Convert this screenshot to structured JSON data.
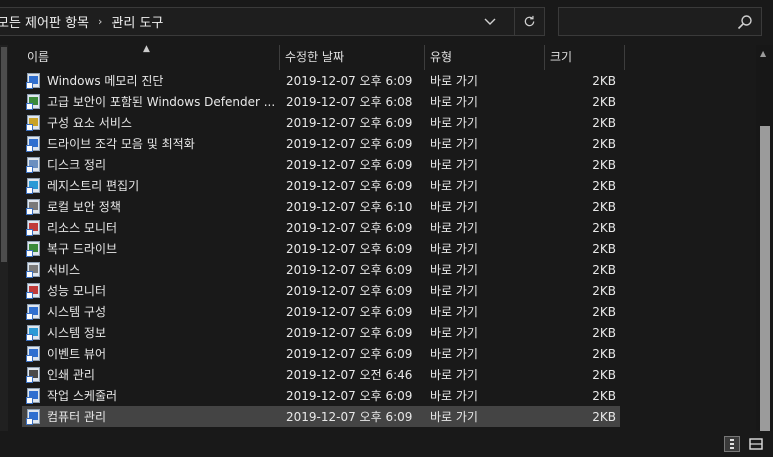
{
  "address": {
    "crumbs": [
      "모든 제어판 항목",
      "관리 도구"
    ],
    "separator": "›"
  },
  "search": {
    "placeholder": ""
  },
  "columns": {
    "name": "이름",
    "date": "수정한 날짜",
    "type": "유형",
    "size": "크기"
  },
  "files": [
    {
      "name": "Windows 메모리 진단",
      "date": "2019-12-07 오후 6:09",
      "type": "바로 가기",
      "size": "2KB",
      "icon": "memory-diagnostic-icon"
    },
    {
      "name": "고급 보안이 포함된 Windows Defender ...",
      "date": "2019-12-07 오후 6:08",
      "type": "바로 가기",
      "size": "2KB",
      "icon": "firewall-icon"
    },
    {
      "name": "구성 요소 서비스",
      "date": "2019-12-07 오후 6:09",
      "type": "바로 가기",
      "size": "2KB",
      "icon": "component-services-icon"
    },
    {
      "name": "드라이브 조각 모음 및 최적화",
      "date": "2019-12-07 오후 6:09",
      "type": "바로 가기",
      "size": "2KB",
      "icon": "defrag-icon"
    },
    {
      "name": "디스크 정리",
      "date": "2019-12-07 오후 6:09",
      "type": "바로 가기",
      "size": "2KB",
      "icon": "disk-cleanup-icon"
    },
    {
      "name": "레지스트리 편집기",
      "date": "2019-12-07 오후 6:09",
      "type": "바로 가기",
      "size": "2KB",
      "icon": "registry-editor-icon"
    },
    {
      "name": "로컬 보안 정책",
      "date": "2019-12-07 오후 6:10",
      "type": "바로 가기",
      "size": "2KB",
      "icon": "local-security-policy-icon"
    },
    {
      "name": "리소스 모니터",
      "date": "2019-12-07 오후 6:09",
      "type": "바로 가기",
      "size": "2KB",
      "icon": "resource-monitor-icon"
    },
    {
      "name": "복구 드라이브",
      "date": "2019-12-07 오후 6:09",
      "type": "바로 가기",
      "size": "2KB",
      "icon": "recovery-drive-icon"
    },
    {
      "name": "서비스",
      "date": "2019-12-07 오후 6:09",
      "type": "바로 가기",
      "size": "2KB",
      "icon": "services-icon"
    },
    {
      "name": "성능 모니터",
      "date": "2019-12-07 오후 6:09",
      "type": "바로 가기",
      "size": "2KB",
      "icon": "performance-monitor-icon"
    },
    {
      "name": "시스템 구성",
      "date": "2019-12-07 오후 6:09",
      "type": "바로 가기",
      "size": "2KB",
      "icon": "system-configuration-icon"
    },
    {
      "name": "시스템 정보",
      "date": "2019-12-07 오후 6:09",
      "type": "바로 가기",
      "size": "2KB",
      "icon": "system-information-icon"
    },
    {
      "name": "이벤트 뷰어",
      "date": "2019-12-07 오후 6:09",
      "type": "바로 가기",
      "size": "2KB",
      "icon": "event-viewer-icon"
    },
    {
      "name": "인쇄 관리",
      "date": "2019-12-07 오전 6:46",
      "type": "바로 가기",
      "size": "2KB",
      "icon": "print-management-icon"
    },
    {
      "name": "작업 스케줄러",
      "date": "2019-12-07 오후 6:09",
      "type": "바로 가기",
      "size": "2KB",
      "icon": "task-scheduler-icon"
    },
    {
      "name": "컴퓨터 관리",
      "date": "2019-12-07 오후 6:09",
      "type": "바로 가기",
      "size": "2KB",
      "icon": "computer-management-icon",
      "selected": true
    }
  ],
  "colors": {
    "background": "#191919",
    "selected_row": "#444444",
    "text": "#e8e8e8"
  }
}
